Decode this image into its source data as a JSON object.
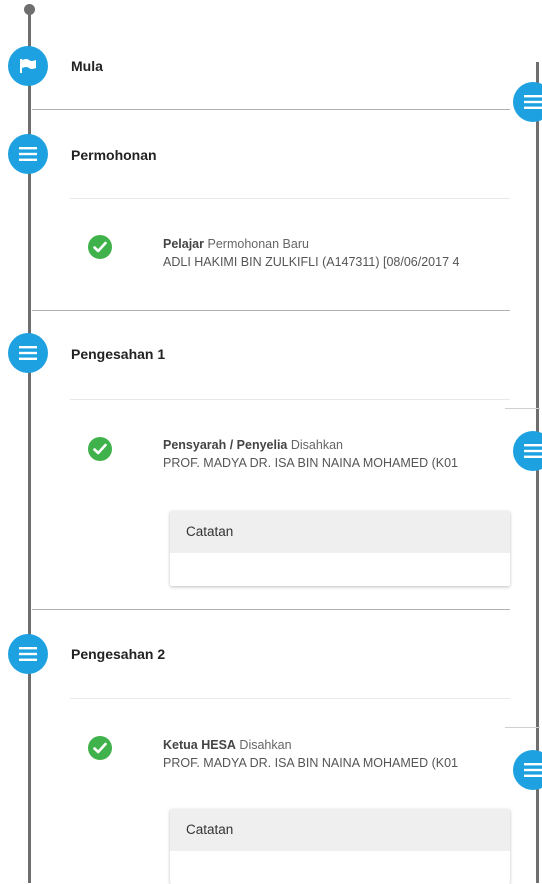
{
  "stages": [
    {
      "title": "Mula",
      "icon": "flag-icon"
    },
    {
      "title": "Permohonan",
      "icon": "menu-icon",
      "entry": {
        "role": "Pelajar",
        "action": "Permohonan Baru",
        "detail": "ADLI HAKIMI BIN ZULKIFLI (A147311) [08/06/2017 4"
      }
    },
    {
      "title": "Pengesahan 1",
      "icon": "menu-icon",
      "entry": {
        "role": "Pensyarah / Penyelia",
        "action": "Disahkan",
        "detail": "PROF. MADYA DR. ISA BIN NAINA MOHAMED (K01"
      },
      "note_label": "Catatan"
    },
    {
      "title": "Pengesahan 2",
      "icon": "menu-icon",
      "entry": {
        "role": "Ketua HESA",
        "action": "Disahkan",
        "detail": "PROF. MADYA DR. ISA BIN NAINA MOHAMED (K01"
      },
      "note_label": "Catatan"
    }
  ],
  "colors": {
    "node_blue": "#1ea1e0",
    "check_green": "#3fb24b",
    "line_gray": "#6e6e6e"
  }
}
